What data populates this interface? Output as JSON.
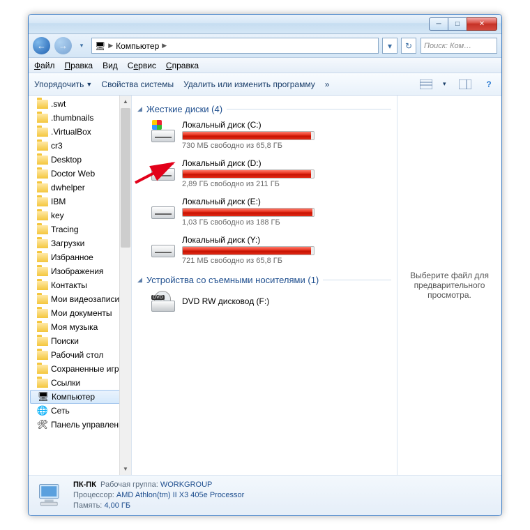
{
  "titlebar": {
    "min": "─",
    "max": "□",
    "close": "✕"
  },
  "address": {
    "icon": "🖥",
    "crumb": "Компьютер",
    "sep": "▶",
    "refresh": "↻",
    "search_placeholder": "Поиск: Ком…"
  },
  "menubar": {
    "file": "Файл",
    "edit": "Правка",
    "view": "Вид",
    "tools": "Сервис",
    "help": "Справка"
  },
  "toolbar": {
    "organize": "Упорядочить",
    "props": "Свойства системы",
    "uninstall": "Удалить или изменить программу",
    "more": "»",
    "view_tiny": "▾",
    "help": "?"
  },
  "tree": {
    "folders": [
      ".swt",
      ".thumbnails",
      ".VirtualBox",
      "cr3",
      "Desktop",
      "Doctor Web",
      "dwhelper",
      "IBM",
      "key",
      "Tracing",
      "Загрузки",
      "Избранное",
      "Изображения",
      "Контакты",
      "Мои видеозаписи",
      "Мои документы",
      "Моя музыка",
      "Поиски",
      "Рабочий стол",
      "Сохраненные игры",
      "Ссылки"
    ],
    "computer": "Компьютер",
    "network": "Сеть",
    "control": "Панель управления"
  },
  "content": {
    "group_hdd": "Жесткие диски (4)",
    "group_removable": "Устройства со съемными носителями (1)",
    "drives": [
      {
        "name": "Локальный диск (C:)",
        "free": "730 МБ свободно из 65,8 ГБ",
        "fill": 98,
        "win": true
      },
      {
        "name": "Локальный диск (D:)",
        "free": "2,89 ГБ свободно из 211 ГБ",
        "fill": 98,
        "win": false
      },
      {
        "name": "Локальный диск (E:)",
        "free": "1,03 ГБ свободно из 188 ГБ",
        "fill": 99,
        "win": false
      },
      {
        "name": "Локальный диск (Y:)",
        "free": "721 МБ свободно из 65,8 ГБ",
        "fill": 98,
        "win": false
      }
    ],
    "dvd": {
      "label": "DVD",
      "name": "DVD RW дисковод (F:)"
    }
  },
  "preview": {
    "text": "Выберите файл для предварительного просмотра."
  },
  "status": {
    "name": "ПК-ПК",
    "wg_key": "Рабочая группа:",
    "wg_val": "WORKGROUP",
    "cpu_key": "Процессор:",
    "cpu_val": "AMD Athlon(tm) II X3 405e Processor",
    "mem_key": "Память:",
    "mem_val": "4,00 ГБ"
  }
}
